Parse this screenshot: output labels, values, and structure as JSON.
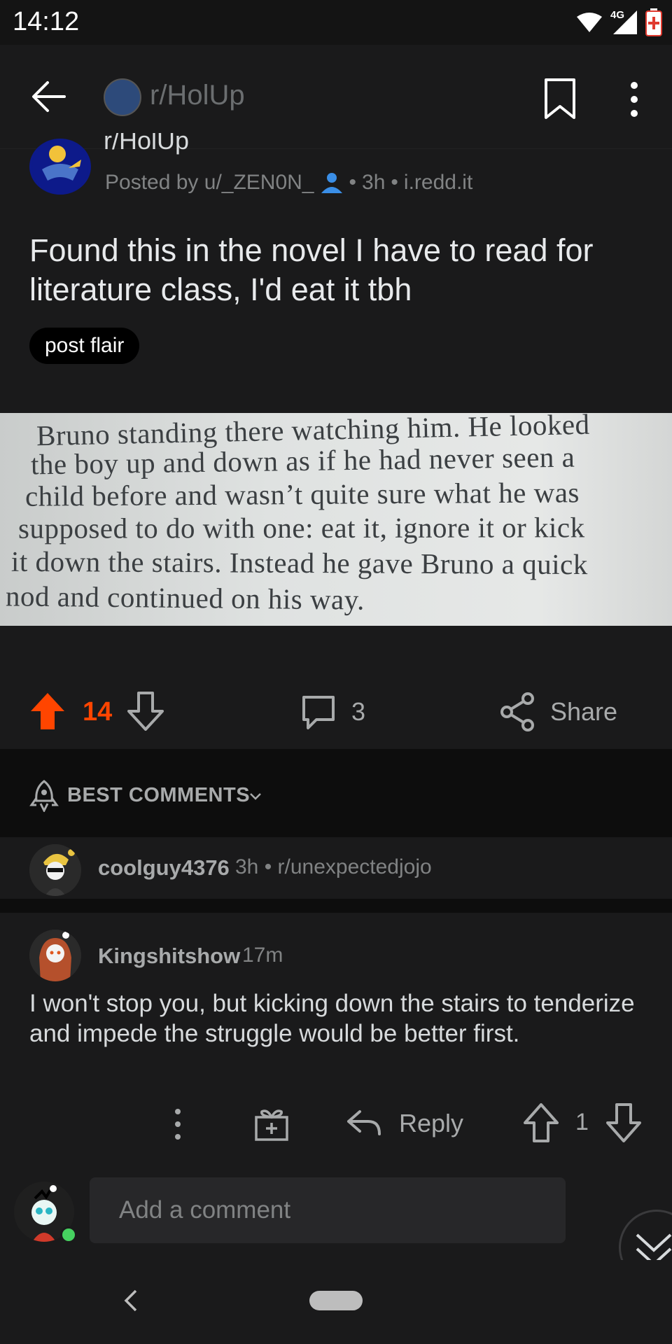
{
  "status_bar": {
    "time": "14:12",
    "network": "4G"
  },
  "app_bar": {
    "subreddit": "r/HolUp"
  },
  "post": {
    "subreddit_cut": "r/HolUp",
    "posted_by": "Posted by u/_ZEN0N_",
    "age": "3h",
    "domain": "i.redd.it",
    "title": "Found this in the novel I have to read for literature class, I'd eat it tbh",
    "flair": "post flair",
    "image_text": [
      "Bruno standing there watching him. He looked",
      "the boy up and down as if he had never seen a",
      "child before and wasn’t quite sure what he was",
      "supposed to do with one: eat it, ignore it or kick",
      "it down the stairs. Instead he gave Bruno a quick",
      "nod and continued on his way."
    ],
    "votes": "14",
    "comments": "3",
    "share_label": "Share"
  },
  "sort": {
    "label": "BEST COMMENTS"
  },
  "collapsed_comment": {
    "author": "coolguy4376",
    "meta": "3h • r/unexpectedjojo"
  },
  "comment": {
    "author": "Kingshitshow",
    "time": "17m",
    "body": "I won't stop you, but kicking down the stairs to tenderize and impede the struggle would be better first.",
    "reply_label": "Reply",
    "votes": "1"
  },
  "compose": {
    "placeholder": "Add a comment"
  },
  "colors": {
    "upvote": "#ff4500",
    "background": "#1a1a1b",
    "online": "#46d160"
  }
}
